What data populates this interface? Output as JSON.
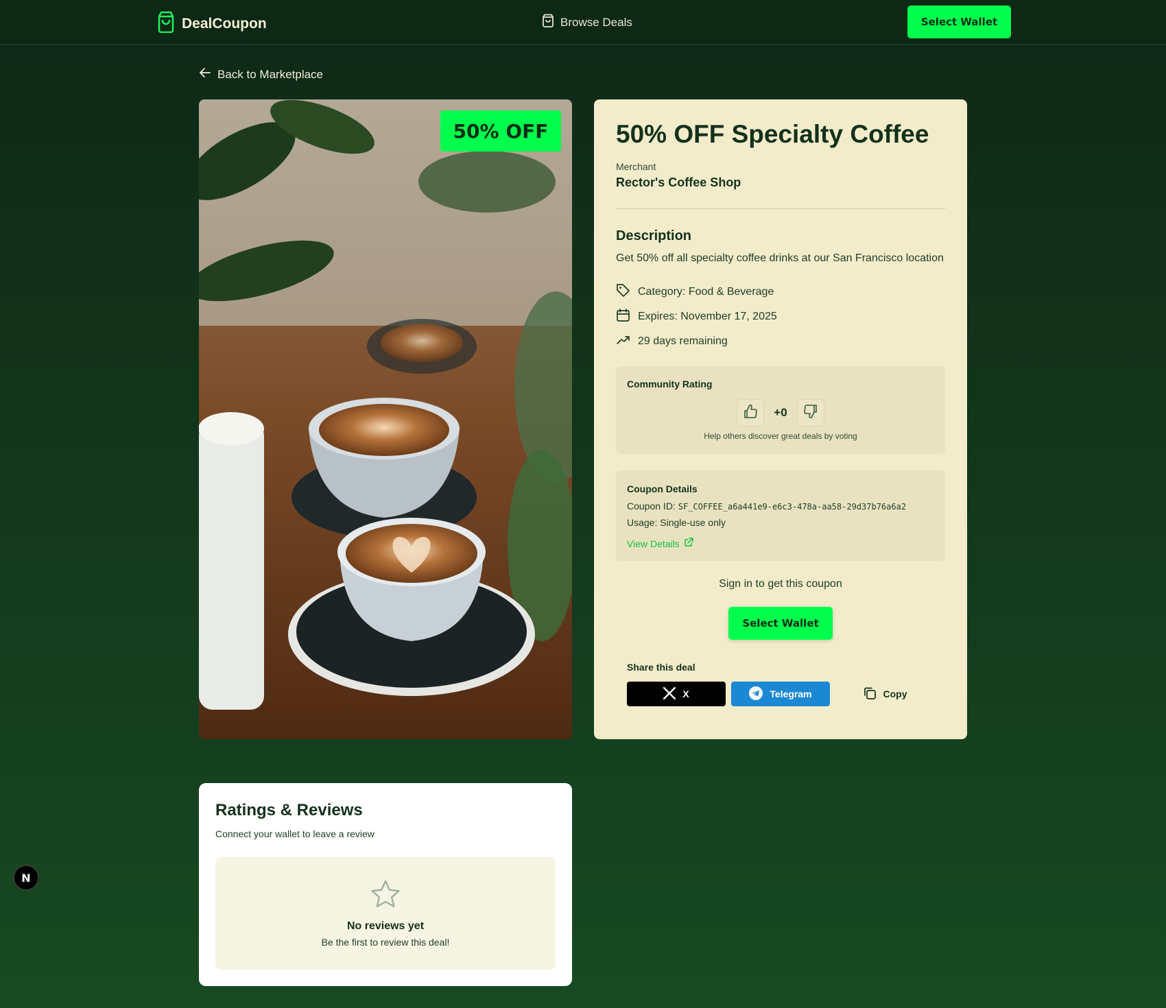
{
  "header": {
    "brand": "DealCoupon",
    "nav_browse": "Browse Deals",
    "wallet_button": "Select Wallet"
  },
  "back_link": "Back to Marketplace",
  "deal": {
    "badge": "50% OFF",
    "image_icon": "coffee-cups-photo",
    "title": "50% OFF Specialty Coffee",
    "merchant_label": "Merchant",
    "merchant_name": "Rector's Coffee Shop",
    "description_title": "Description",
    "description": "Get 50% off all specialty coffee drinks at our San Francisco location",
    "category": "Category: Food & Beverage",
    "expires": "Expires: November 17, 2025",
    "remaining": "29 days remaining"
  },
  "community_rating": {
    "title": "Community Rating",
    "score": "+0",
    "help_text": "Help others discover great deals by voting"
  },
  "coupon_details": {
    "title": "Coupon Details",
    "id_label": "Coupon ID:",
    "id_value": "SF_COFFEE_a6a441e9-e6c3-478a-aa58-29d37b76a6a2",
    "usage": "Usage: Single-use only",
    "view_link": "View Details"
  },
  "sign_in": {
    "text": "Sign in to get this coupon",
    "button": "Select Wallet"
  },
  "share": {
    "title": "Share this deal",
    "x_label": "X",
    "telegram_label": "Telegram",
    "copy_label": "Copy"
  },
  "reviews": {
    "title": "Ratings & Reviews",
    "subtitle": "Connect your wallet to leave a review",
    "empty_title": "No reviews yet",
    "empty_subtitle": "Be the first to review this deal!"
  },
  "next_badge": "N",
  "colors": {
    "accent": "#00ff4c",
    "card_bg": "#f2eccb",
    "page_bg": "#143b1d",
    "telegram": "#1b88d4"
  }
}
